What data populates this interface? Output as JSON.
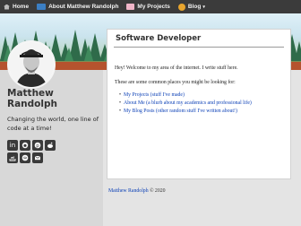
{
  "nav": {
    "items": [
      {
        "label": "Home",
        "icon": "home-icon"
      },
      {
        "label": "About Matthew Randolph",
        "icon": "id-card-icon"
      },
      {
        "label": "My Projects",
        "icon": "projects-icon"
      },
      {
        "label": "Blog",
        "icon": "blog-icon",
        "caret": "▾"
      }
    ]
  },
  "sidebar": {
    "name": "Matthew Randolph",
    "bio": "Changing the world, one line of code at a time!",
    "social_icons": [
      "linkedin-icon",
      "github-icon",
      "pinterest-icon",
      "reddit-icon",
      "stackoverflow-icon",
      "spotify-icon",
      "email-icon"
    ]
  },
  "main": {
    "title": "Software Developer",
    "intro": "Hey! Welcome to my area of the internet. I write stuff here.",
    "lead": "These are some common places you might be looking for:",
    "links": [
      "My Projects (stuff I've made)",
      "About Me (a blurb about my academics and professional life)",
      "My Blog Posts (other random stuff I've written about!)"
    ]
  },
  "footer": {
    "author": "Matthew Randolph",
    "copyright": "© 2020"
  },
  "colors": {
    "navbar": "#3b3b3b",
    "link": "#0a3fb6",
    "sidebar": "#d8d8d8",
    "page": "#e4e4e4"
  }
}
